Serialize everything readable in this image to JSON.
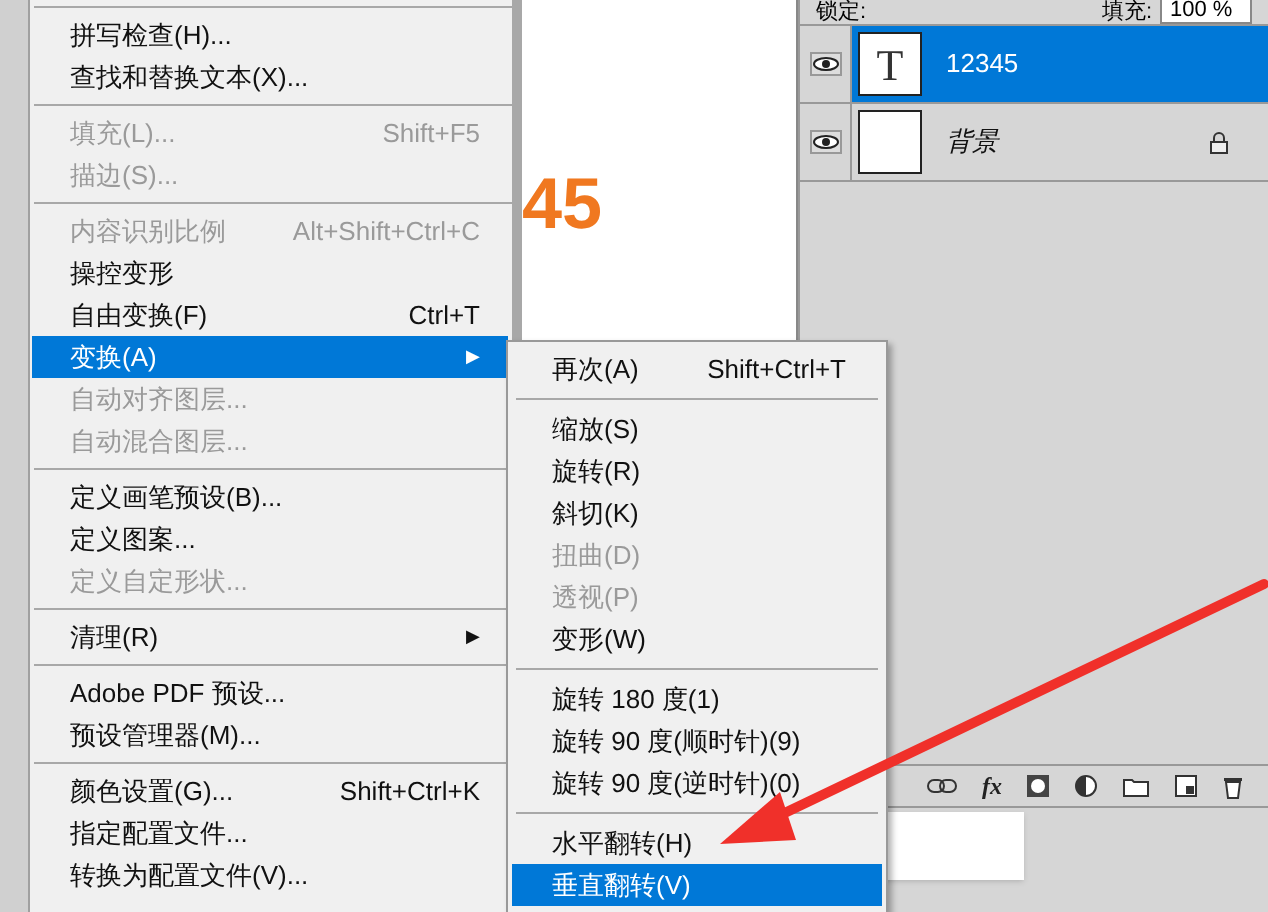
{
  "menu": {
    "items": [
      {
        "kind": "separator"
      },
      {
        "kind": "item",
        "label": "拼写检查(H)...",
        "disabled": false,
        "selected": false
      },
      {
        "kind": "item",
        "label": "查找和替换文本(X)...",
        "disabled": false,
        "selected": false
      },
      {
        "kind": "separator"
      },
      {
        "kind": "item",
        "label": "填充(L)...",
        "shortcut": "Shift+F5",
        "disabled": true,
        "selected": false
      },
      {
        "kind": "item",
        "label": "描边(S)...",
        "disabled": true,
        "selected": false
      },
      {
        "kind": "separator"
      },
      {
        "kind": "item",
        "label": "内容识别比例",
        "shortcut": "Alt+Shift+Ctrl+C",
        "disabled": true,
        "selected": false
      },
      {
        "kind": "item",
        "label": "操控变形",
        "disabled": false,
        "selected": false
      },
      {
        "kind": "item",
        "label": "自由变换(F)",
        "shortcut": "Ctrl+T",
        "disabled": false,
        "selected": false
      },
      {
        "kind": "item",
        "label": "变换(A)",
        "submenu": "▶",
        "disabled": false,
        "selected": true
      },
      {
        "kind": "item",
        "label": "自动对齐图层...",
        "disabled": true,
        "selected": false
      },
      {
        "kind": "item",
        "label": "自动混合图层...",
        "disabled": true,
        "selected": false
      },
      {
        "kind": "separator"
      },
      {
        "kind": "item",
        "label": "定义画笔预设(B)...",
        "disabled": false,
        "selected": false
      },
      {
        "kind": "item",
        "label": "定义图案...",
        "disabled": false,
        "selected": false
      },
      {
        "kind": "item",
        "label": "定义自定形状...",
        "disabled": true,
        "selected": false
      },
      {
        "kind": "separator"
      },
      {
        "kind": "item",
        "label": "清理(R)",
        "submenu": "▶",
        "disabled": false,
        "selected": false
      },
      {
        "kind": "separator"
      },
      {
        "kind": "item",
        "label": "Adobe PDF 预设...",
        "disabled": false,
        "selected": false
      },
      {
        "kind": "item",
        "label": "预设管理器(M)...",
        "disabled": false,
        "selected": false
      },
      {
        "kind": "separator"
      },
      {
        "kind": "item",
        "label": "颜色设置(G)...",
        "shortcut": "Shift+Ctrl+K",
        "disabled": false,
        "selected": false
      },
      {
        "kind": "item",
        "label": "指定配置文件...",
        "disabled": false,
        "selected": false
      },
      {
        "kind": "item",
        "label": "转换为配置文件(V)...",
        "disabled": false,
        "selected": false
      }
    ]
  },
  "submenu": {
    "items": [
      {
        "kind": "item",
        "label": "再次(A)",
        "shortcut": "Shift+Ctrl+T",
        "disabled": false,
        "selected": false
      },
      {
        "kind": "separator"
      },
      {
        "kind": "item",
        "label": "缩放(S)",
        "disabled": false,
        "selected": false
      },
      {
        "kind": "item",
        "label": "旋转(R)",
        "disabled": false,
        "selected": false
      },
      {
        "kind": "item",
        "label": "斜切(K)",
        "disabled": false,
        "selected": false
      },
      {
        "kind": "item",
        "label": "扭曲(D)",
        "disabled": true,
        "selected": false
      },
      {
        "kind": "item",
        "label": "透视(P)",
        "disabled": true,
        "selected": false
      },
      {
        "kind": "item",
        "label": "变形(W)",
        "disabled": false,
        "selected": false
      },
      {
        "kind": "separator"
      },
      {
        "kind": "item",
        "label": "旋转 180 度(1)",
        "disabled": false,
        "selected": false
      },
      {
        "kind": "item",
        "label": "旋转 90 度(顺时针)(9)",
        "disabled": false,
        "selected": false
      },
      {
        "kind": "item",
        "label": "旋转 90 度(逆时针)(0)",
        "disabled": false,
        "selected": false
      },
      {
        "kind": "separator"
      },
      {
        "kind": "item",
        "label": "水平翻转(H)",
        "disabled": false,
        "selected": false
      },
      {
        "kind": "item",
        "label": "垂直翻转(V)",
        "disabled": false,
        "selected": true
      }
    ]
  },
  "canvas": {
    "text": "45"
  },
  "layers_panel": {
    "fx_button": "fx",
    "lock_label": "锁定:",
    "fill_label": "填充:",
    "fill_value": "100 %",
    "layers": [
      {
        "name": "12345",
        "thumbnail": "T",
        "selected": true,
        "visible": true,
        "locked": false
      },
      {
        "name": "背景",
        "selected": false,
        "visible": true,
        "locked": true
      }
    ]
  }
}
